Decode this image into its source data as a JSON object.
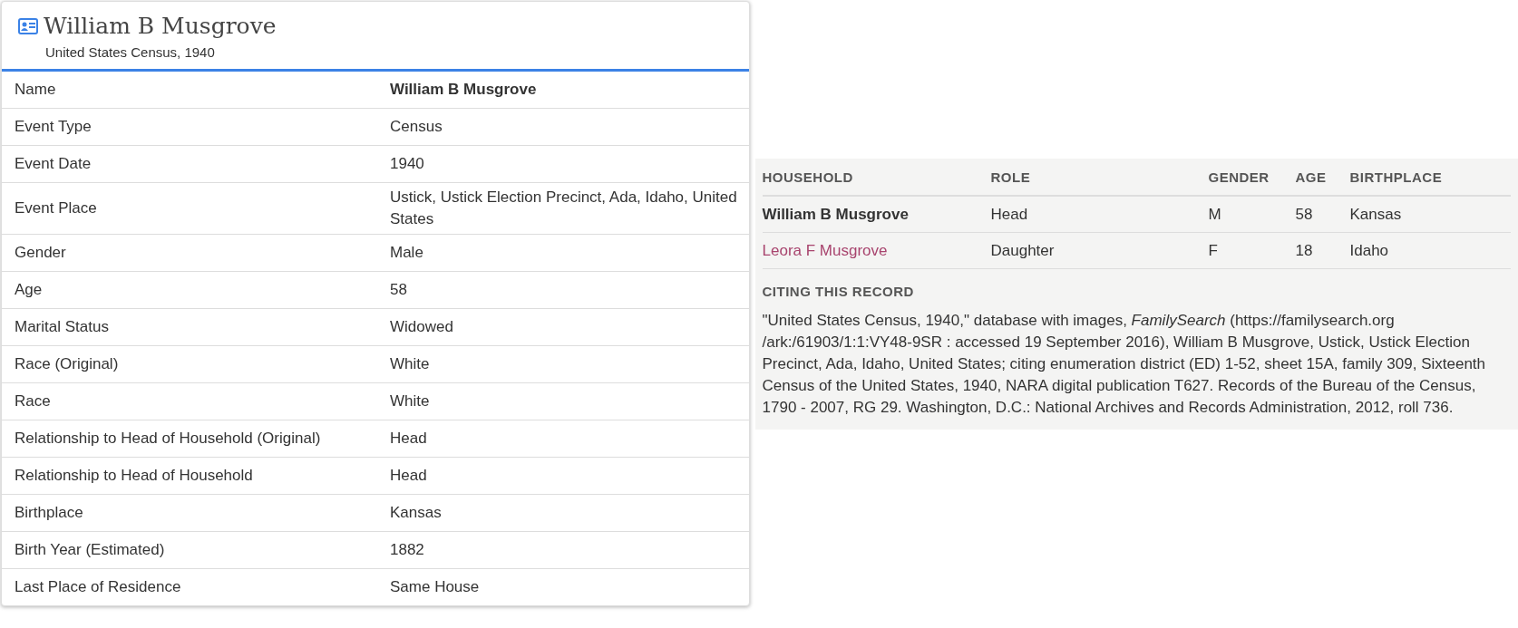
{
  "record": {
    "title": "William B Musgrove",
    "subtitle": "United States Census, 1940",
    "fields": [
      {
        "label": "Name",
        "value": "William B Musgrove",
        "emphasis": true
      },
      {
        "label": "Event Type",
        "value": "Census",
        "emphasis": false
      },
      {
        "label": "Event Date",
        "value": "1940",
        "emphasis": false
      },
      {
        "label": "Event Place",
        "value": "Ustick, Ustick Election Precinct, Ada, Idaho, United States",
        "emphasis": false
      },
      {
        "label": "Gender",
        "value": "Male",
        "emphasis": false
      },
      {
        "label": "Age",
        "value": "58",
        "emphasis": false
      },
      {
        "label": "Marital Status",
        "value": "Widowed",
        "emphasis": false
      },
      {
        "label": "Race (Original)",
        "value": "White",
        "emphasis": false
      },
      {
        "label": "Race",
        "value": "White",
        "emphasis": false
      },
      {
        "label": "Relationship to Head of Household (Original)",
        "value": "Head",
        "emphasis": false
      },
      {
        "label": "Relationship to Head of Household",
        "value": "Head",
        "emphasis": false
      },
      {
        "label": "Birthplace",
        "value": "Kansas",
        "emphasis": false
      },
      {
        "label": "Birth Year (Estimated)",
        "value": "1882",
        "emphasis": false
      },
      {
        "label": "Last Place of Residence",
        "value": "Same House",
        "emphasis": false
      }
    ]
  },
  "household": {
    "columns": [
      "HOUSEHOLD",
      "ROLE",
      "GENDER",
      "AGE",
      "BIRTHPLACE"
    ],
    "rows": [
      {
        "kind": "current",
        "name": "William B Musgrove",
        "role": "Head",
        "gender": "M",
        "age": "58",
        "birthplace": "Kansas"
      },
      {
        "kind": "link",
        "name": "Leora F Musgrove",
        "role": "Daughter",
        "gender": "F",
        "age": "18",
        "birthplace": "Idaho"
      }
    ]
  },
  "citation": {
    "heading": "CITING THIS RECORD",
    "text": "\"United States Census, 1940,\" database with images, *FamilySearch* (https://familysearch.org /ark:/61903/1:1:VY48-9SR : accessed 19 September 2016), William B Musgrove, Ustick, Ustick Election Precinct, Ada, Idaho, United States; citing enumeration district (ED) 1-52, sheet 15A, family 309, Sixteenth Census of the United States, 1940, NARA digital publication T627. Records of the Bureau of the Census, 1790 - 2007, RG 29. Washington, D.C.: National Archives and Records Administration, 2012, roll 736."
  }
}
